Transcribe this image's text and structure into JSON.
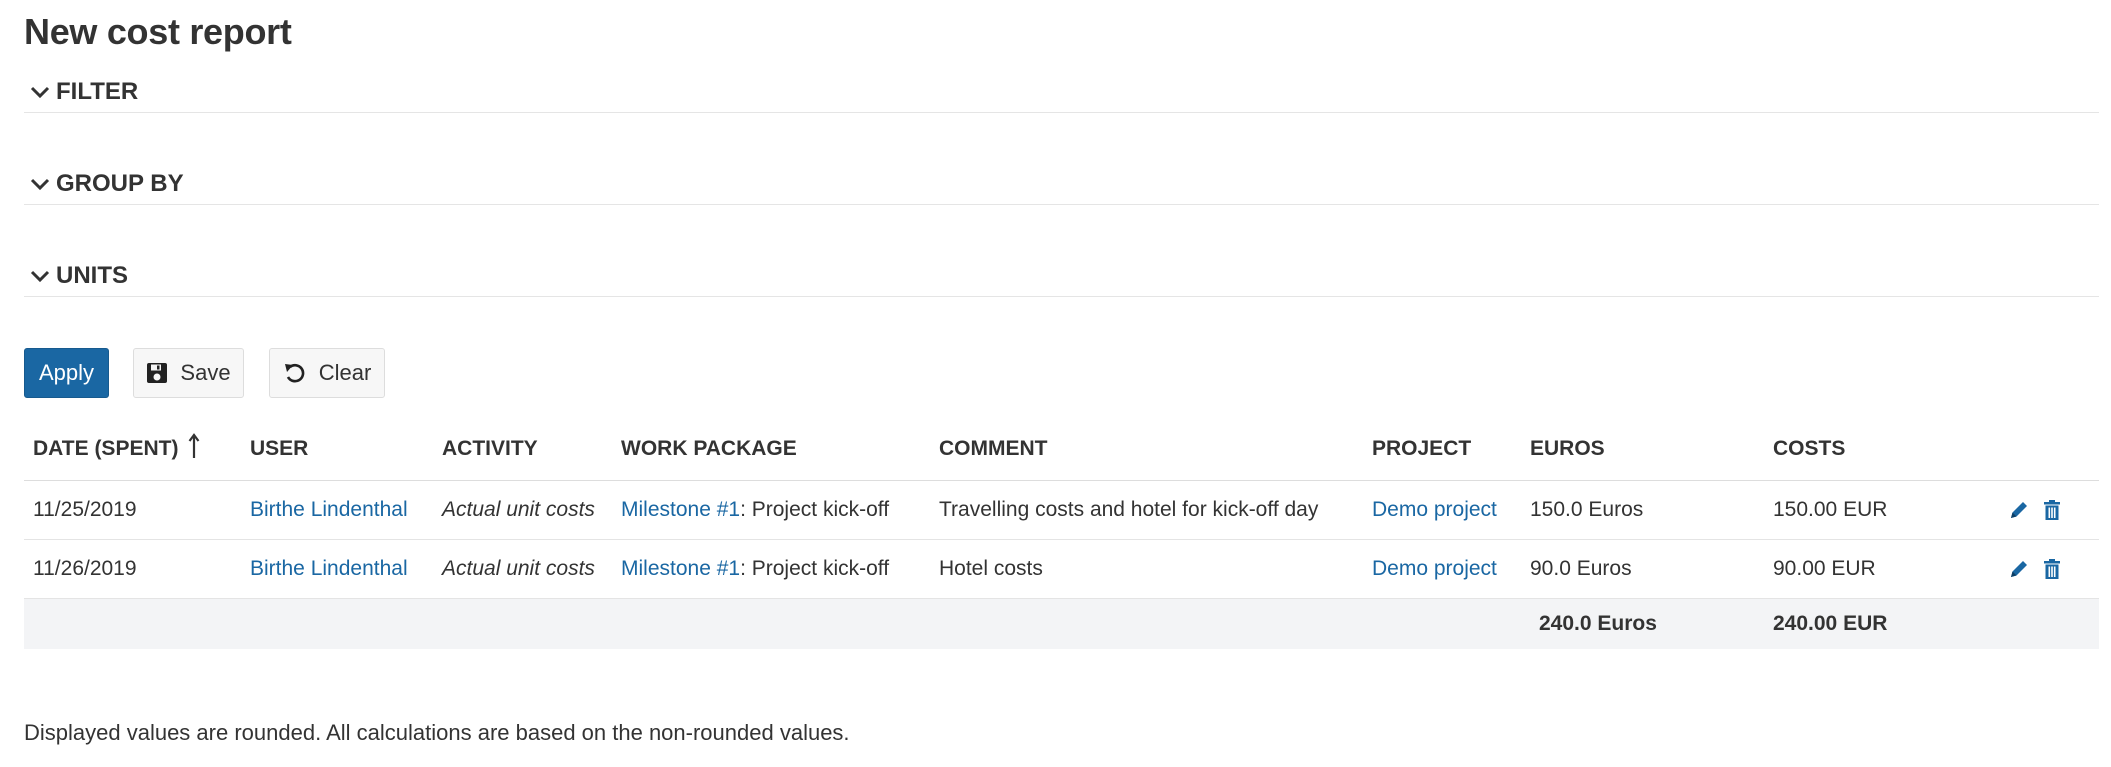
{
  "page_title": "New cost report",
  "sections": {
    "filter": "FILTER",
    "group_by": "GROUP BY",
    "units": "UNITS"
  },
  "buttons": {
    "apply": "Apply",
    "save": "Save",
    "clear": "Clear"
  },
  "table": {
    "headers": {
      "date": "DATE (SPENT)",
      "user": "USER",
      "activity": "ACTIVITY",
      "work_package": "WORK PACKAGE",
      "comment": "COMMENT",
      "project": "PROJECT",
      "euros": "EUROS",
      "costs": "COSTS"
    },
    "sort_icon": "sort-ascending-arrow-icon",
    "rows": [
      {
        "date": "11/25/2019",
        "user": "Birthe Lindenthal",
        "activity": "Actual unit costs",
        "wp_link": "Milestone #1",
        "wp_text": ": Project kick-off",
        "comment": "Travelling costs and hotel for kick-off day",
        "project": "Demo project",
        "euros": "150.0 Euros",
        "costs": "150.00 EUR"
      },
      {
        "date": "11/26/2019",
        "user": "Birthe Lindenthal",
        "activity": "Actual unit costs",
        "wp_link": "Milestone #1",
        "wp_text": ": Project kick-off",
        "comment": "Hotel costs",
        "project": "Demo project",
        "euros": "90.0 Euros",
        "costs": "90.00 EUR"
      }
    ],
    "totals": {
      "euros": "240.0 Euros",
      "costs": "240.00 EUR"
    }
  },
  "footnote": "Displayed values are rounded. All calculations are based on the non-rounded values.",
  "colors": {
    "link": "#1a67a3",
    "primary_button": "#1a67a3",
    "totals_row_bg": "#f3f4f6"
  }
}
